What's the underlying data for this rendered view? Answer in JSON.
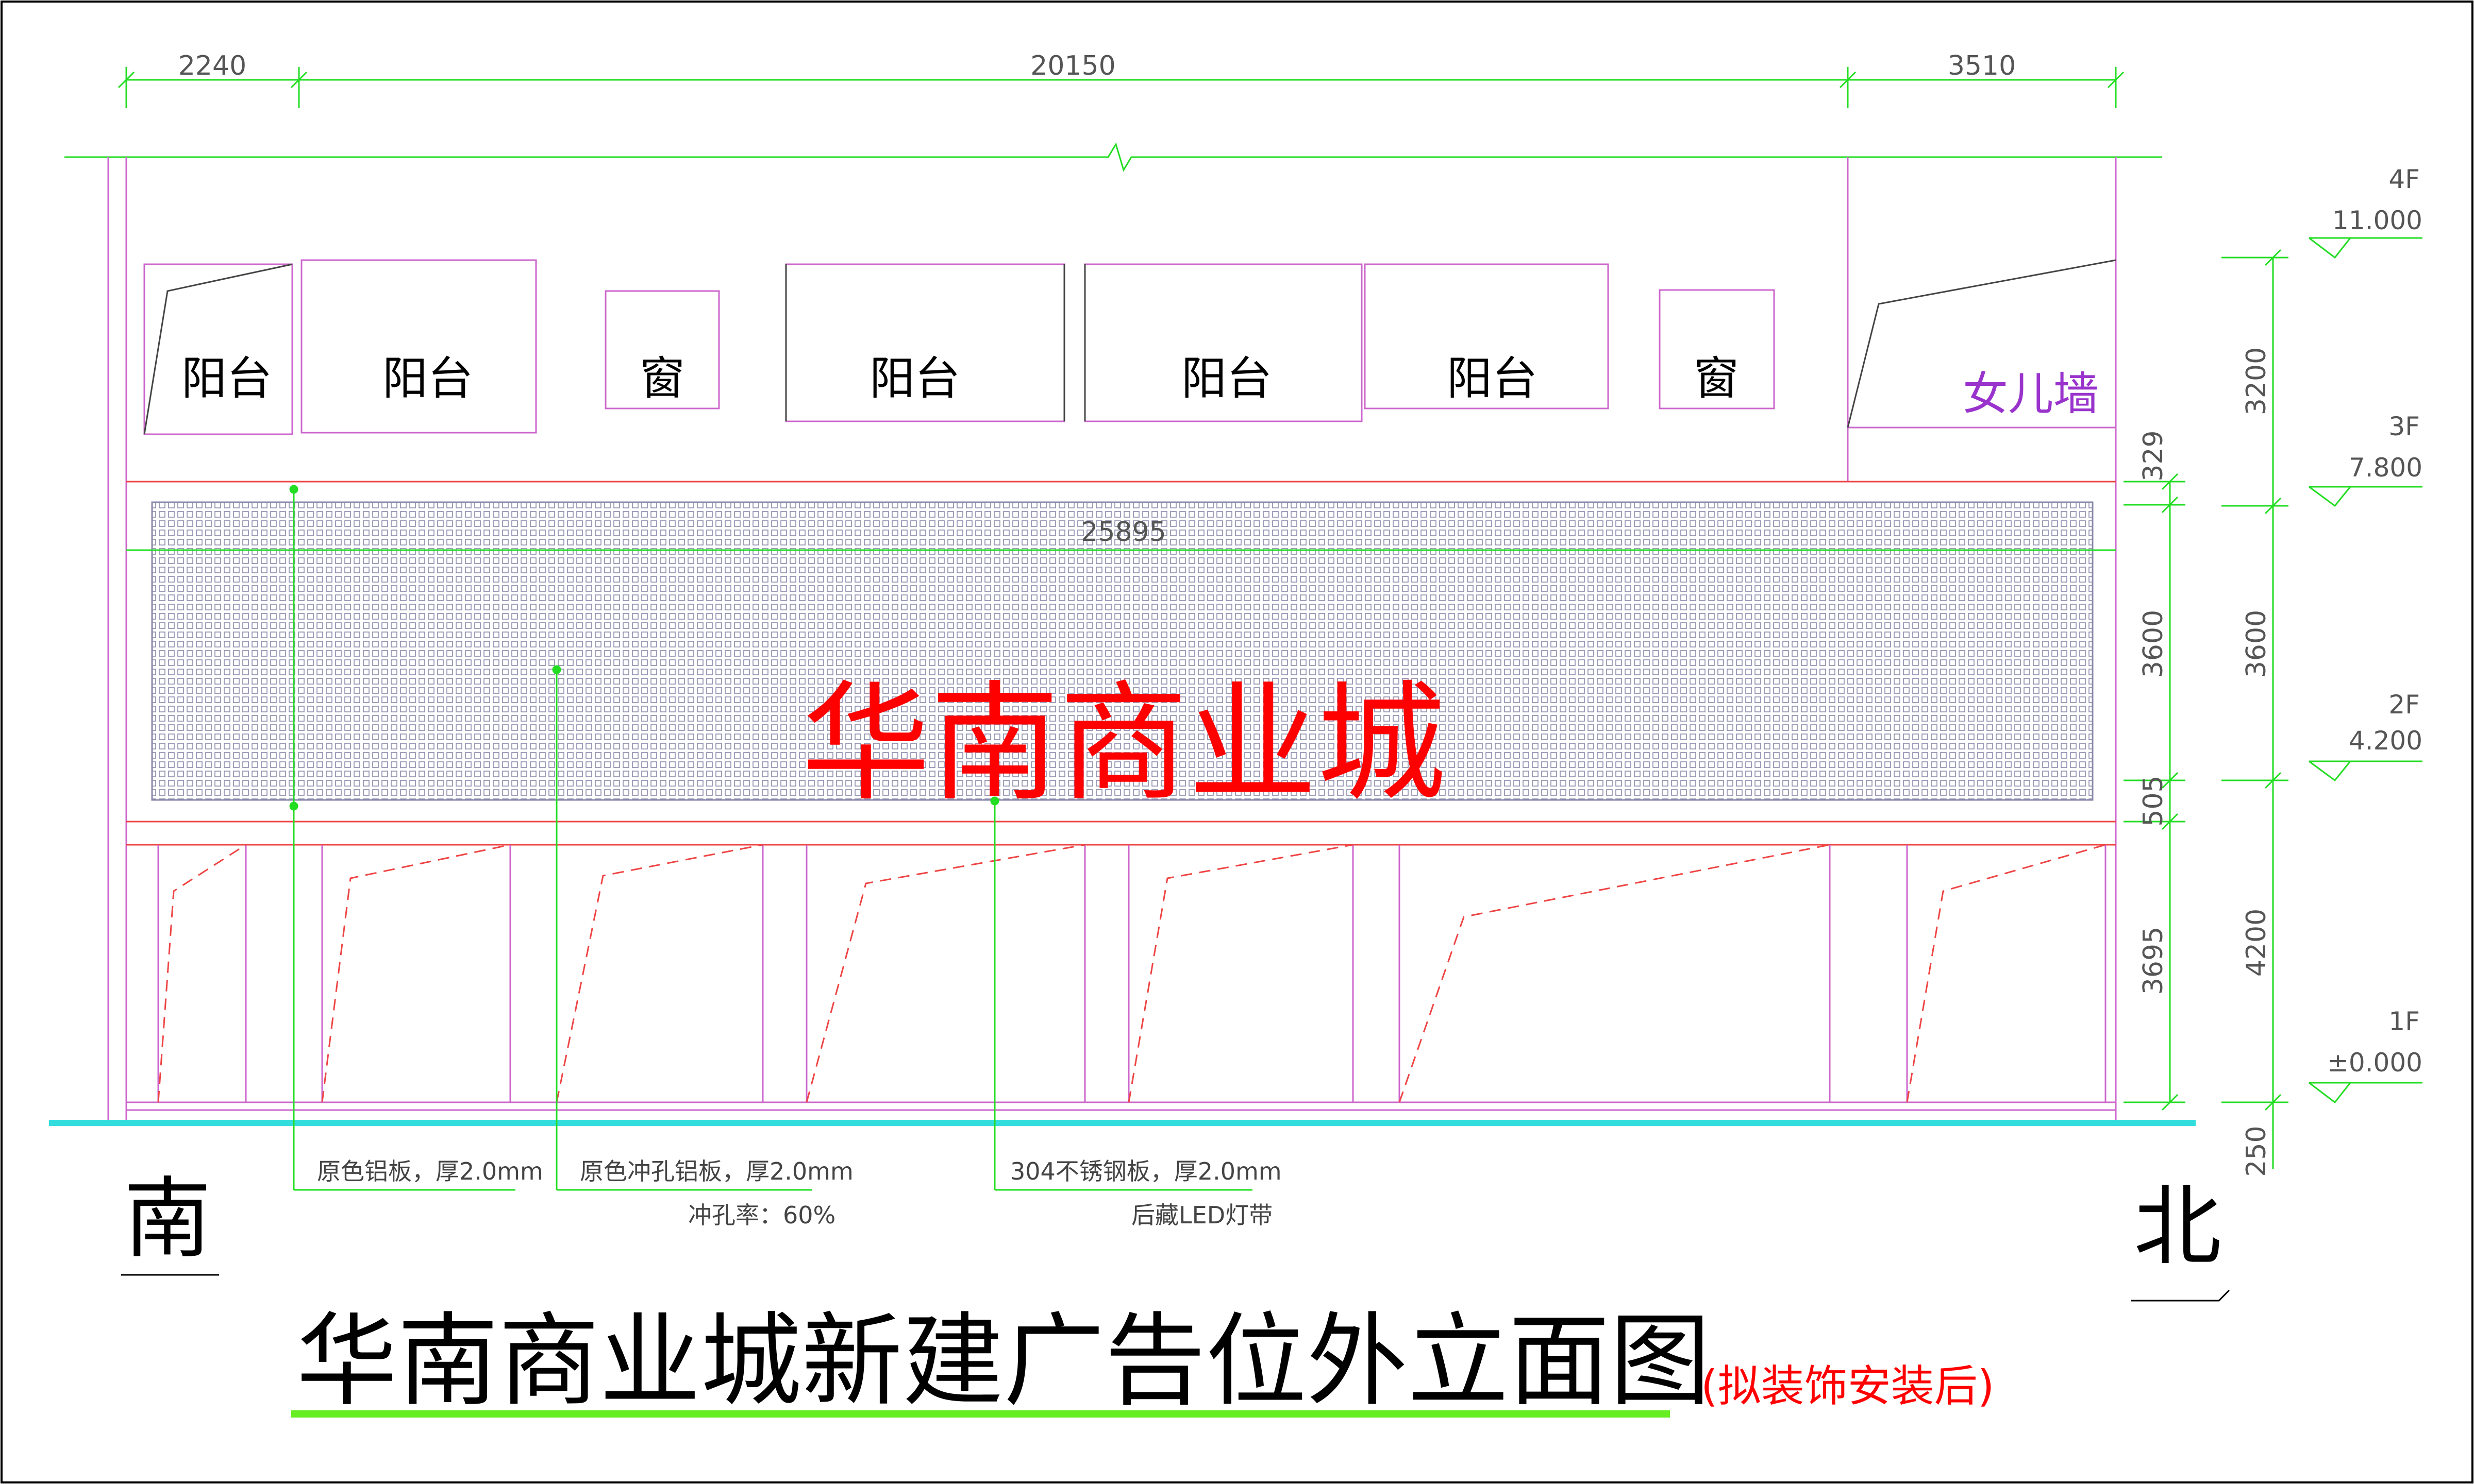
{
  "title": "华南商业城新建广告位外立面图",
  "subtitle": "(拟装饰安装后)",
  "sign_text": "华南商业城",
  "compass": {
    "left": "南",
    "right": "北"
  },
  "top_dims": [
    "2240",
    "20150",
    "3510"
  ],
  "overall_dim": "25895",
  "rooms": [
    "阳台",
    "阳台",
    "窗",
    "阳台",
    "阳台",
    "阳台",
    "窗"
  ],
  "parapet": "女儿墙",
  "levels": [
    {
      "floor": "4F",
      "elevation": "11.000"
    },
    {
      "floor": "3F",
      "elevation": "7.800"
    },
    {
      "floor": "2F",
      "elevation": "4.200"
    },
    {
      "floor": "1F",
      "elevation": "±0.000"
    }
  ],
  "inner_dims": [
    "329",
    "3600",
    "505",
    "3695"
  ],
  "outer_dims": [
    "3200",
    "3600",
    "4200",
    "250"
  ],
  "annotations": [
    {
      "line1": "原色铝板，厚2.0mm",
      "line2": ""
    },
    {
      "line1": "原色冲孔铝板，厚2.0mm",
      "line2": "冲孔率：60%"
    },
    {
      "line1": "304不锈钢板，厚2.0mm",
      "line2": "后藏LED灯带"
    }
  ],
  "colors": {
    "dimension": "#22dd22",
    "outline": "#cc66cc",
    "sign": "#ff0000",
    "ground": "#33dddd",
    "title_underline": "#66ee22"
  }
}
